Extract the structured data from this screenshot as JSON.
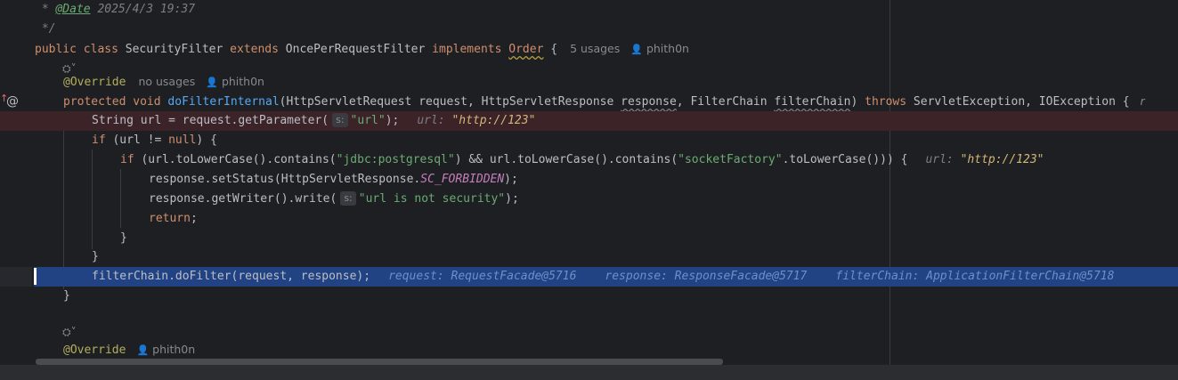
{
  "editor": {
    "lines": {
      "doc_date_prefix": " * ",
      "doc_date_tag": "@Date",
      "doc_date_value": " 2025/4/3 19:37",
      "doc_close": " */",
      "class_public": "public",
      "class_class": "class",
      "class_name": "SecurityFilter",
      "class_extends": "extends",
      "class_parent": "OncePerRequestFilter",
      "class_implements": "implements",
      "class_iface": "Order",
      "class_brace": "{",
      "class_usages": "5 usages",
      "class_author": "phith0n",
      "override1": "@Override",
      "override1_usages": "no usages",
      "override1_author": "phith0n",
      "method_protected": "protected",
      "method_void": "void",
      "method_name": "doFilterInternal",
      "method_params_1": "(HttpServletRequest request, HttpServletResponse ",
      "method_param_response": "response",
      "method_params_2": ", FilterChain ",
      "method_param_chain": "filterChain",
      "method_params_3": ") ",
      "method_throws": "throws",
      "method_params_4": " ServletException, IOException {",
      "method_author_cut": "r",
      "l_url_decl": "String url = request.getParameter(",
      "l_url_inlay": "s:",
      "l_url_str": "\"url\"",
      "l_url_end": ");",
      "l_url_dbg_name": "url:",
      "l_url_dbg_val": "\"http://123\"",
      "l_if_kw": "if",
      "l_if_cond": " (url != ",
      "l_if_null": "null",
      "l_if_end": ") {",
      "l_if2_kw": "if",
      "l_if2_a": " (url.toLowerCase().contains(",
      "l_if2_str1": "\"jdbc:postgresql\"",
      "l_if2_b": ") && url.toLowerCase().contains(",
      "l_if2_str2": "\"socketFactory\"",
      "l_if2_c": ".toLowerCase())) {",
      "l_if2_dbg_name": "url:",
      "l_if2_dbg_val": "\"http://123\"",
      "l_status_a": "response.setStatus(HttpServletResponse.",
      "l_status_const": "SC_FORBIDDEN",
      "l_status_end": ");",
      "l_write_a": "response.getWriter().write(",
      "l_write_inlay": "s:",
      "l_write_str": "\"url is not security\"",
      "l_write_end": ");",
      "l_return": "return",
      "l_return_end": ";",
      "l_close_inner": "}",
      "l_close_if": "}",
      "l_dofilter": "filterChain.doFilter(request, response);",
      "l_dofilter_dbg1": "request: RequestFacade@5716",
      "l_dofilter_dbg2": "response: ResponseFacade@5717",
      "l_dofilter_dbg3": "filterChain: ApplicationFilterChain@5718",
      "l_close_method": "}",
      "override2": "@Override",
      "override2_author": "phith0n"
    }
  },
  "colors": {
    "background": "#1e1f22",
    "breakpoint_line": "#3b2327",
    "execution_line": "#214283",
    "keyword": "#cf8e6d",
    "string": "#6aab73",
    "function": "#56a8f5"
  }
}
